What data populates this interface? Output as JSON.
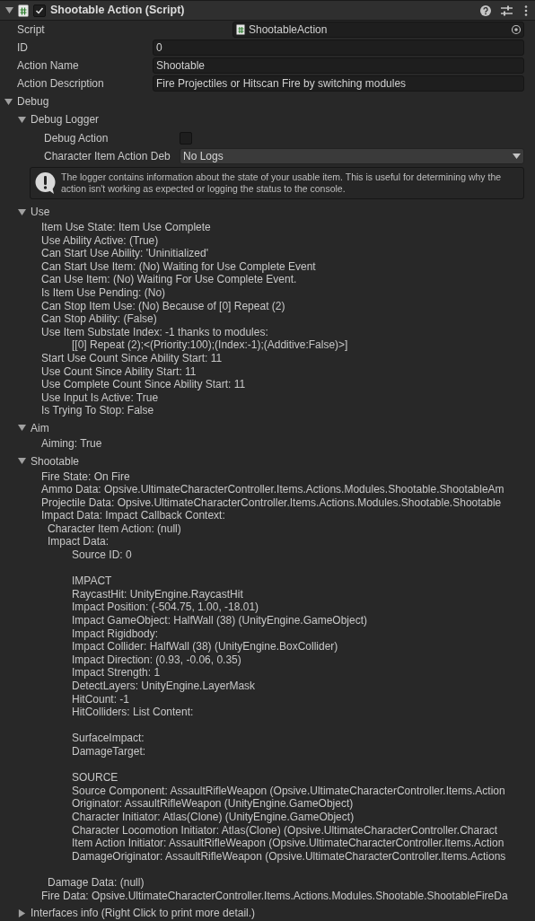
{
  "component": {
    "title": "Shootable Action (Script)",
    "expanded": true,
    "enabled": true
  },
  "fields": [
    {
      "kind": "object",
      "label": "Script",
      "value": "ShootableAction"
    },
    {
      "kind": "text",
      "label": "ID",
      "value": "0"
    },
    {
      "kind": "text",
      "label": "Action Name",
      "value": "Shootable"
    },
    {
      "kind": "text",
      "label": "Action Description",
      "value": "Fire Projectiles or Hitscan Fire by switching modules"
    }
  ],
  "debug": {
    "label": "Debug",
    "expanded": true,
    "logger": {
      "label": "Debug Logger",
      "expanded": true,
      "debug_action": {
        "label": "Debug Action",
        "checked": false
      },
      "log_level": {
        "label": "Character Item Action Deb",
        "value": "No Logs"
      },
      "help": "The logger contains information about the state of your usable item. This is useful for determining why the action isn't working as expected or logging the status to the console."
    },
    "sections": [
      {
        "label": "Use",
        "expanded": true,
        "lines": [
          {
            "text": "Item Use State: Item Use Complete"
          },
          {
            "text": "Use Ability Active: (True)"
          },
          {
            "text": "Can Start Use Ability: 'Uninitialized'"
          },
          {
            "text": "Can Start Use Item: (No) Waiting for Use Complete Event"
          },
          {
            "text": "Can Use Item: (No) Waiting For Use Complete Event."
          },
          {
            "text": "Is Item Use Pending: (No)"
          },
          {
            "text": "Can Stop Item Use: (No) Because of [0] Repeat (2)"
          },
          {
            "text": "Can Stop Ability: (False)"
          },
          {
            "text": "Use Item Substate Index: -1 thanks to modules:",
            "children": [
              {
                "text": "[[0] Repeat (2);<(Priority:100);(Index:-1);(Additive:False)>]"
              }
            ]
          },
          {
            "text": "Start Use Count Since Ability Start: 11"
          },
          {
            "text": "Use Count Since Ability Start: 11"
          },
          {
            "text": "Use Complete Count Since Ability Start: 11"
          },
          {
            "text": "Use Input Is Active: True"
          },
          {
            "text": "Is Trying To Stop: False"
          }
        ]
      },
      {
        "label": "Aim",
        "expanded": true,
        "lines": [
          {
            "text": "Aiming: True"
          }
        ]
      },
      {
        "label": "Shootable",
        "expanded": true,
        "lines": [
          {
            "text": "Fire State: On Fire"
          },
          {
            "text": "Ammo Data: Opsive.UltimateCharacterController.Items.Actions.Modules.Shootable.ShootableAm"
          },
          {
            "text": "Projectile Data: Opsive.UltimateCharacterController.Items.Actions.Modules.Shootable.Shootable"
          },
          {
            "text": "Impact Data: Impact Callback Context:",
            "children": [
              {
                "text": "Character Item Action: (null)"
              },
              {
                "text": "Impact Data:",
                "children": [
                  {
                    "text": "Source ID: 0"
                  },
                  {
                    "text": "IMPACT",
                    "gap_before": true
                  },
                  {
                    "text": "RaycastHit: UnityEngine.RaycastHit"
                  },
                  {
                    "text": "Impact Position: (-504.75, 1.00, -18.01)"
                  },
                  {
                    "text": "Impact GameObject: HalfWall (38) (UnityEngine.GameObject)"
                  },
                  {
                    "text": "Impact Rigidbody:"
                  },
                  {
                    "text": "Impact Collider: HalfWall (38) (UnityEngine.BoxCollider)"
                  },
                  {
                    "text": "Impact Direction: (0.93, -0.06, 0.35)"
                  },
                  {
                    "text": "Impact Strength: 1"
                  },
                  {
                    "text": "DetectLayers: UnityEngine.LayerMask"
                  },
                  {
                    "text": "HitCount: -1"
                  },
                  {
                    "text": "HitColliders: List Content:"
                  },
                  {
                    "text": "SurfaceImpact:",
                    "gap_before": true
                  },
                  {
                    "text": "DamageTarget:"
                  },
                  {
                    "text": "SOURCE",
                    "gap_before": true
                  },
                  {
                    "text": "Source Component: AssaultRifleWeapon (Opsive.UltimateCharacterController.Items.Action"
                  },
                  {
                    "text": "Originator: AssaultRifleWeapon (UnityEngine.GameObject)"
                  },
                  {
                    "text": "Character Initiator: Atlas(Clone) (UnityEngine.GameObject)"
                  },
                  {
                    "text": "Character Locomotion Initiator: Atlas(Clone) (Opsive.UltimateCharacterController.Charact"
                  },
                  {
                    "text": "Item Action Initiator: AssaultRifleWeapon (Opsive.UltimateCharacterController.Items.Action"
                  },
                  {
                    "text": "DamageOriginator: AssaultRifleWeapon (Opsive.UltimateCharacterController.Items.Actions"
                  }
                ]
              },
              {
                "text": "Damage Data: (null)",
                "gap_before": true
              }
            ]
          },
          {
            "text": "Fire Data: Opsive.UltimateCharacterController.Items.Actions.Modules.Shootable.ShootableFireDa"
          }
        ]
      }
    ]
  },
  "interfaces": {
    "label": "Interfaces info (Right Click to print more detail.)",
    "expanded": false
  }
}
